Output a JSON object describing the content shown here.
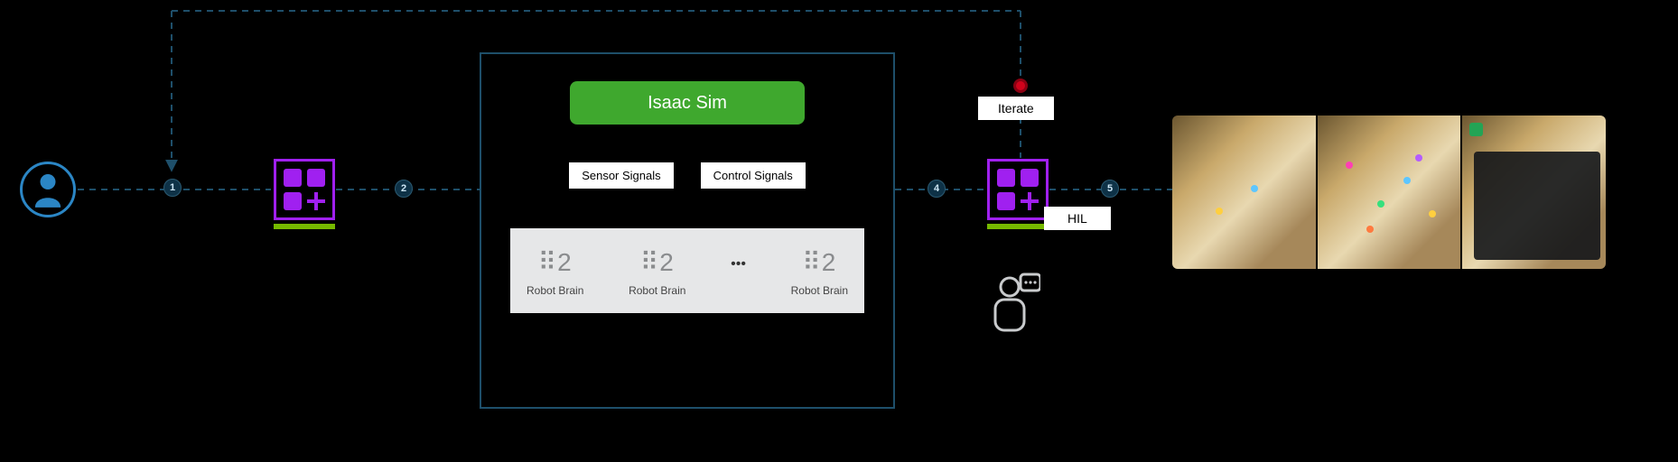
{
  "steps": [
    "1",
    "2",
    "4",
    "5"
  ],
  "user_icon": "user-icon",
  "omni_icon": "omniverse-extension-icon",
  "sim": {
    "title": "Isaac Sim",
    "signals": {
      "sensor": "Sensor Signals",
      "control": "Control Signals"
    },
    "brain_label": "Robot Brain",
    "brain_glyph": "⠿2",
    "ellipsis": "•••"
  },
  "iterate_label": "Iterate",
  "hil_label": "HIL",
  "hil_icon": "human-in-loop-icon",
  "preview_label": "simulation-preview-panels"
}
